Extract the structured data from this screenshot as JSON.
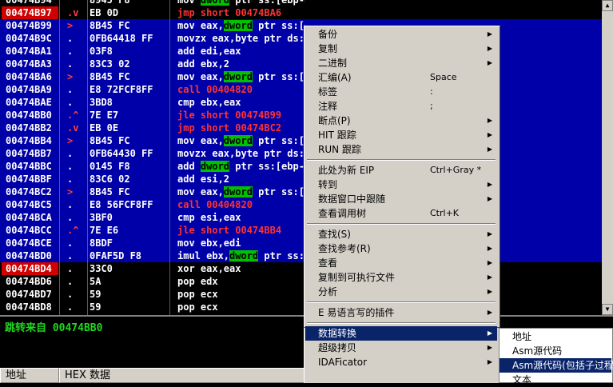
{
  "colors": {
    "selection": "#0000a8",
    "address_highlight": "#d00000",
    "jump": "#ff3333",
    "register_highlight": "#00c000",
    "info_text": "#1fd81f",
    "menu_bg": "#d4d0c8",
    "menu_highlight": "#0a246a"
  },
  "disasm": {
    "rows": [
      {
        "addr": "00474B94",
        "mark": "",
        "hex": "8945 F8",
        "parts": [
          {
            "t": "mov "
          },
          {
            "t": "dword",
            "k": "kw"
          },
          {
            "t": " ptr ss:[ebp-8],eax"
          }
        ]
      },
      {
        "addr": "00474B97",
        "mark": ".v",
        "hex": "EB 0D",
        "parts": [
          {
            "t": "jmp short 00474BA6",
            "k": "red"
          }
        ]
      },
      {
        "addr": "00474B99",
        "mark": ">",
        "hex": "8B45 FC",
        "parts": [
          {
            "t": "mov eax,"
          },
          {
            "t": "dword",
            "k": "kw"
          },
          {
            "t": " ptr ss:[ebp-4]"
          }
        ]
      },
      {
        "addr": "00474B9C",
        "mark": ".",
        "hex": "0FB64418 FF",
        "parts": [
          {
            "t": "movzx eax,byte ptr ds:[eax+ebx-1]"
          }
        ]
      },
      {
        "addr": "00474BA1",
        "mark": ".",
        "hex": "03F8",
        "parts": [
          {
            "t": "add edi,eax"
          }
        ]
      },
      {
        "addr": "00474BA3",
        "mark": ".",
        "hex": "83C3 02",
        "parts": [
          {
            "t": "add ebx,2"
          }
        ]
      },
      {
        "addr": "00474BA6",
        "mark": ">",
        "hex": "8B45 FC",
        "parts": [
          {
            "t": "mov eax,"
          },
          {
            "t": "dword",
            "k": "kw"
          },
          {
            "t": " ptr ss:[ebp-4]"
          }
        ]
      },
      {
        "addr": "00474BA9",
        "mark": ".",
        "hex": "E8 72FCF8FF",
        "parts": [
          {
            "t": "call 00404820",
            "k": "red"
          }
        ]
      },
      {
        "addr": "00474BAE",
        "mark": ".",
        "hex": "3BD8",
        "parts": [
          {
            "t": "cmp ebx,eax"
          }
        ]
      },
      {
        "addr": "00474BB0",
        "mark": ".^",
        "hex": "7E E7",
        "parts": [
          {
            "t": "jle short 00474B99",
            "k": "red"
          }
        ]
      },
      {
        "addr": "00474BB2",
        "mark": ".v",
        "hex": "EB 0E",
        "parts": [
          {
            "t": "jmp short 00474BC2",
            "k": "red"
          }
        ]
      },
      {
        "addr": "00474BB4",
        "mark": ">",
        "hex": "8B45 FC",
        "parts": [
          {
            "t": "mov eax,"
          },
          {
            "t": "dword",
            "k": "kw"
          },
          {
            "t": " ptr ss:[ebp-4]"
          }
        ]
      },
      {
        "addr": "00474BB7",
        "mark": ".",
        "hex": "0FB64430 FF",
        "parts": [
          {
            "t": "movzx eax,byte ptr ds:[eax+esi-1]"
          }
        ]
      },
      {
        "addr": "00474BBC",
        "mark": ".",
        "hex": "0145 F8",
        "parts": [
          {
            "t": "add "
          },
          {
            "t": "dword",
            "k": "kw"
          },
          {
            "t": " ptr ss:[ebp-8],eax"
          }
        ]
      },
      {
        "addr": "00474BBF",
        "mark": ".",
        "hex": "83C6 02",
        "parts": [
          {
            "t": "add esi,2"
          }
        ]
      },
      {
        "addr": "00474BC2",
        "mark": ">",
        "hex": "8B45 FC",
        "parts": [
          {
            "t": "mov eax,"
          },
          {
            "t": "dword",
            "k": "kw"
          },
          {
            "t": " ptr ss:[ebp-4]"
          }
        ]
      },
      {
        "addr": "00474BC5",
        "mark": ".",
        "hex": "E8 56FCF8FF",
        "parts": [
          {
            "t": "call 00404820",
            "k": "red"
          }
        ]
      },
      {
        "addr": "00474BCA",
        "mark": ".",
        "hex": "3BF0",
        "parts": [
          {
            "t": "cmp esi,eax"
          }
        ]
      },
      {
        "addr": "00474BCC",
        "mark": ".^",
        "hex": "7E E6",
        "parts": [
          {
            "t": "jle short 00474BB4",
            "k": "red"
          }
        ]
      },
      {
        "addr": "00474BCE",
        "mark": ".",
        "hex": "8BDF",
        "parts": [
          {
            "t": "mov ebx,edi"
          }
        ]
      },
      {
        "addr": "00474BD0",
        "mark": ".",
        "hex": "0FAF5D F8",
        "parts": [
          {
            "t": "imul ebx,"
          },
          {
            "t": "dword",
            "k": "kw"
          },
          {
            "t": " ptr ss:[ebp-8]"
          }
        ]
      },
      {
        "addr": "00474BD4",
        "mark": ".",
        "hex": "33C0",
        "parts": [
          {
            "t": "xor eax,eax"
          }
        ]
      },
      {
        "addr": "00474BD6",
        "mark": ".",
        "hex": "5A",
        "parts": [
          {
            "t": "pop edx"
          }
        ]
      },
      {
        "addr": "00474BD7",
        "mark": ".",
        "hex": "59",
        "parts": [
          {
            "t": "pop ecx"
          }
        ]
      },
      {
        "addr": "00474BD8",
        "mark": ".",
        "hex": "59",
        "parts": [
          {
            "t": "pop ecx"
          }
        ]
      }
    ]
  },
  "info": {
    "text": "跳转来自 00474BB0"
  },
  "dump": {
    "col_address": "地址",
    "col_hex": "HEX 数据"
  },
  "context_menu": {
    "items": [
      {
        "label": "备份",
        "shortcut": "",
        "arrow": true
      },
      {
        "label": "复制",
        "shortcut": "",
        "arrow": true
      },
      {
        "label": "二进制",
        "shortcut": "",
        "arrow": true
      },
      {
        "label": "汇编(A)",
        "shortcut": "Space",
        "arrow": false
      },
      {
        "label": "标签",
        "shortcut": ":",
        "arrow": false
      },
      {
        "label": "注释",
        "shortcut": ";",
        "arrow": false
      },
      {
        "label": "断点(P)",
        "shortcut": "",
        "arrow": true
      },
      {
        "label": "HIT 跟踪",
        "shortcut": "",
        "arrow": true
      },
      {
        "label": "RUN 跟踪",
        "shortcut": "",
        "arrow": true
      },
      {
        "sep": true
      },
      {
        "label": "此处为新 EIP",
        "shortcut": "Ctrl+Gray *",
        "arrow": false
      },
      {
        "label": "转到",
        "shortcut": "",
        "arrow": true
      },
      {
        "label": "数据窗口中跟随",
        "shortcut": "",
        "arrow": true
      },
      {
        "label": "查看调用树",
        "shortcut": "Ctrl+K",
        "arrow": false
      },
      {
        "sep": true
      },
      {
        "label": "查找(S)",
        "shortcut": "",
        "arrow": true
      },
      {
        "label": "查找参考(R)",
        "shortcut": "",
        "arrow": true
      },
      {
        "label": "查看",
        "shortcut": "",
        "arrow": true
      },
      {
        "label": "复制到可执行文件",
        "shortcut": "",
        "arrow": true
      },
      {
        "label": "分析",
        "shortcut": "",
        "arrow": true
      },
      {
        "sep": true
      },
      {
        "label": "E 易语言写的插件",
        "shortcut": "",
        "arrow": true
      },
      {
        "sep": true
      },
      {
        "label": "数据转换",
        "shortcut": "",
        "arrow": true,
        "highlight": true
      },
      {
        "label": "超级拷贝",
        "shortcut": "",
        "arrow": true
      },
      {
        "label": "IDAFicator",
        "shortcut": "",
        "arrow": true
      }
    ]
  },
  "submenu": {
    "items": [
      {
        "label": "地址"
      },
      {
        "label": "Asm源代码"
      },
      {
        "label": "Asm源代码(包括子过程)",
        "highlight": true
      },
      {
        "label": "文本"
      }
    ]
  }
}
